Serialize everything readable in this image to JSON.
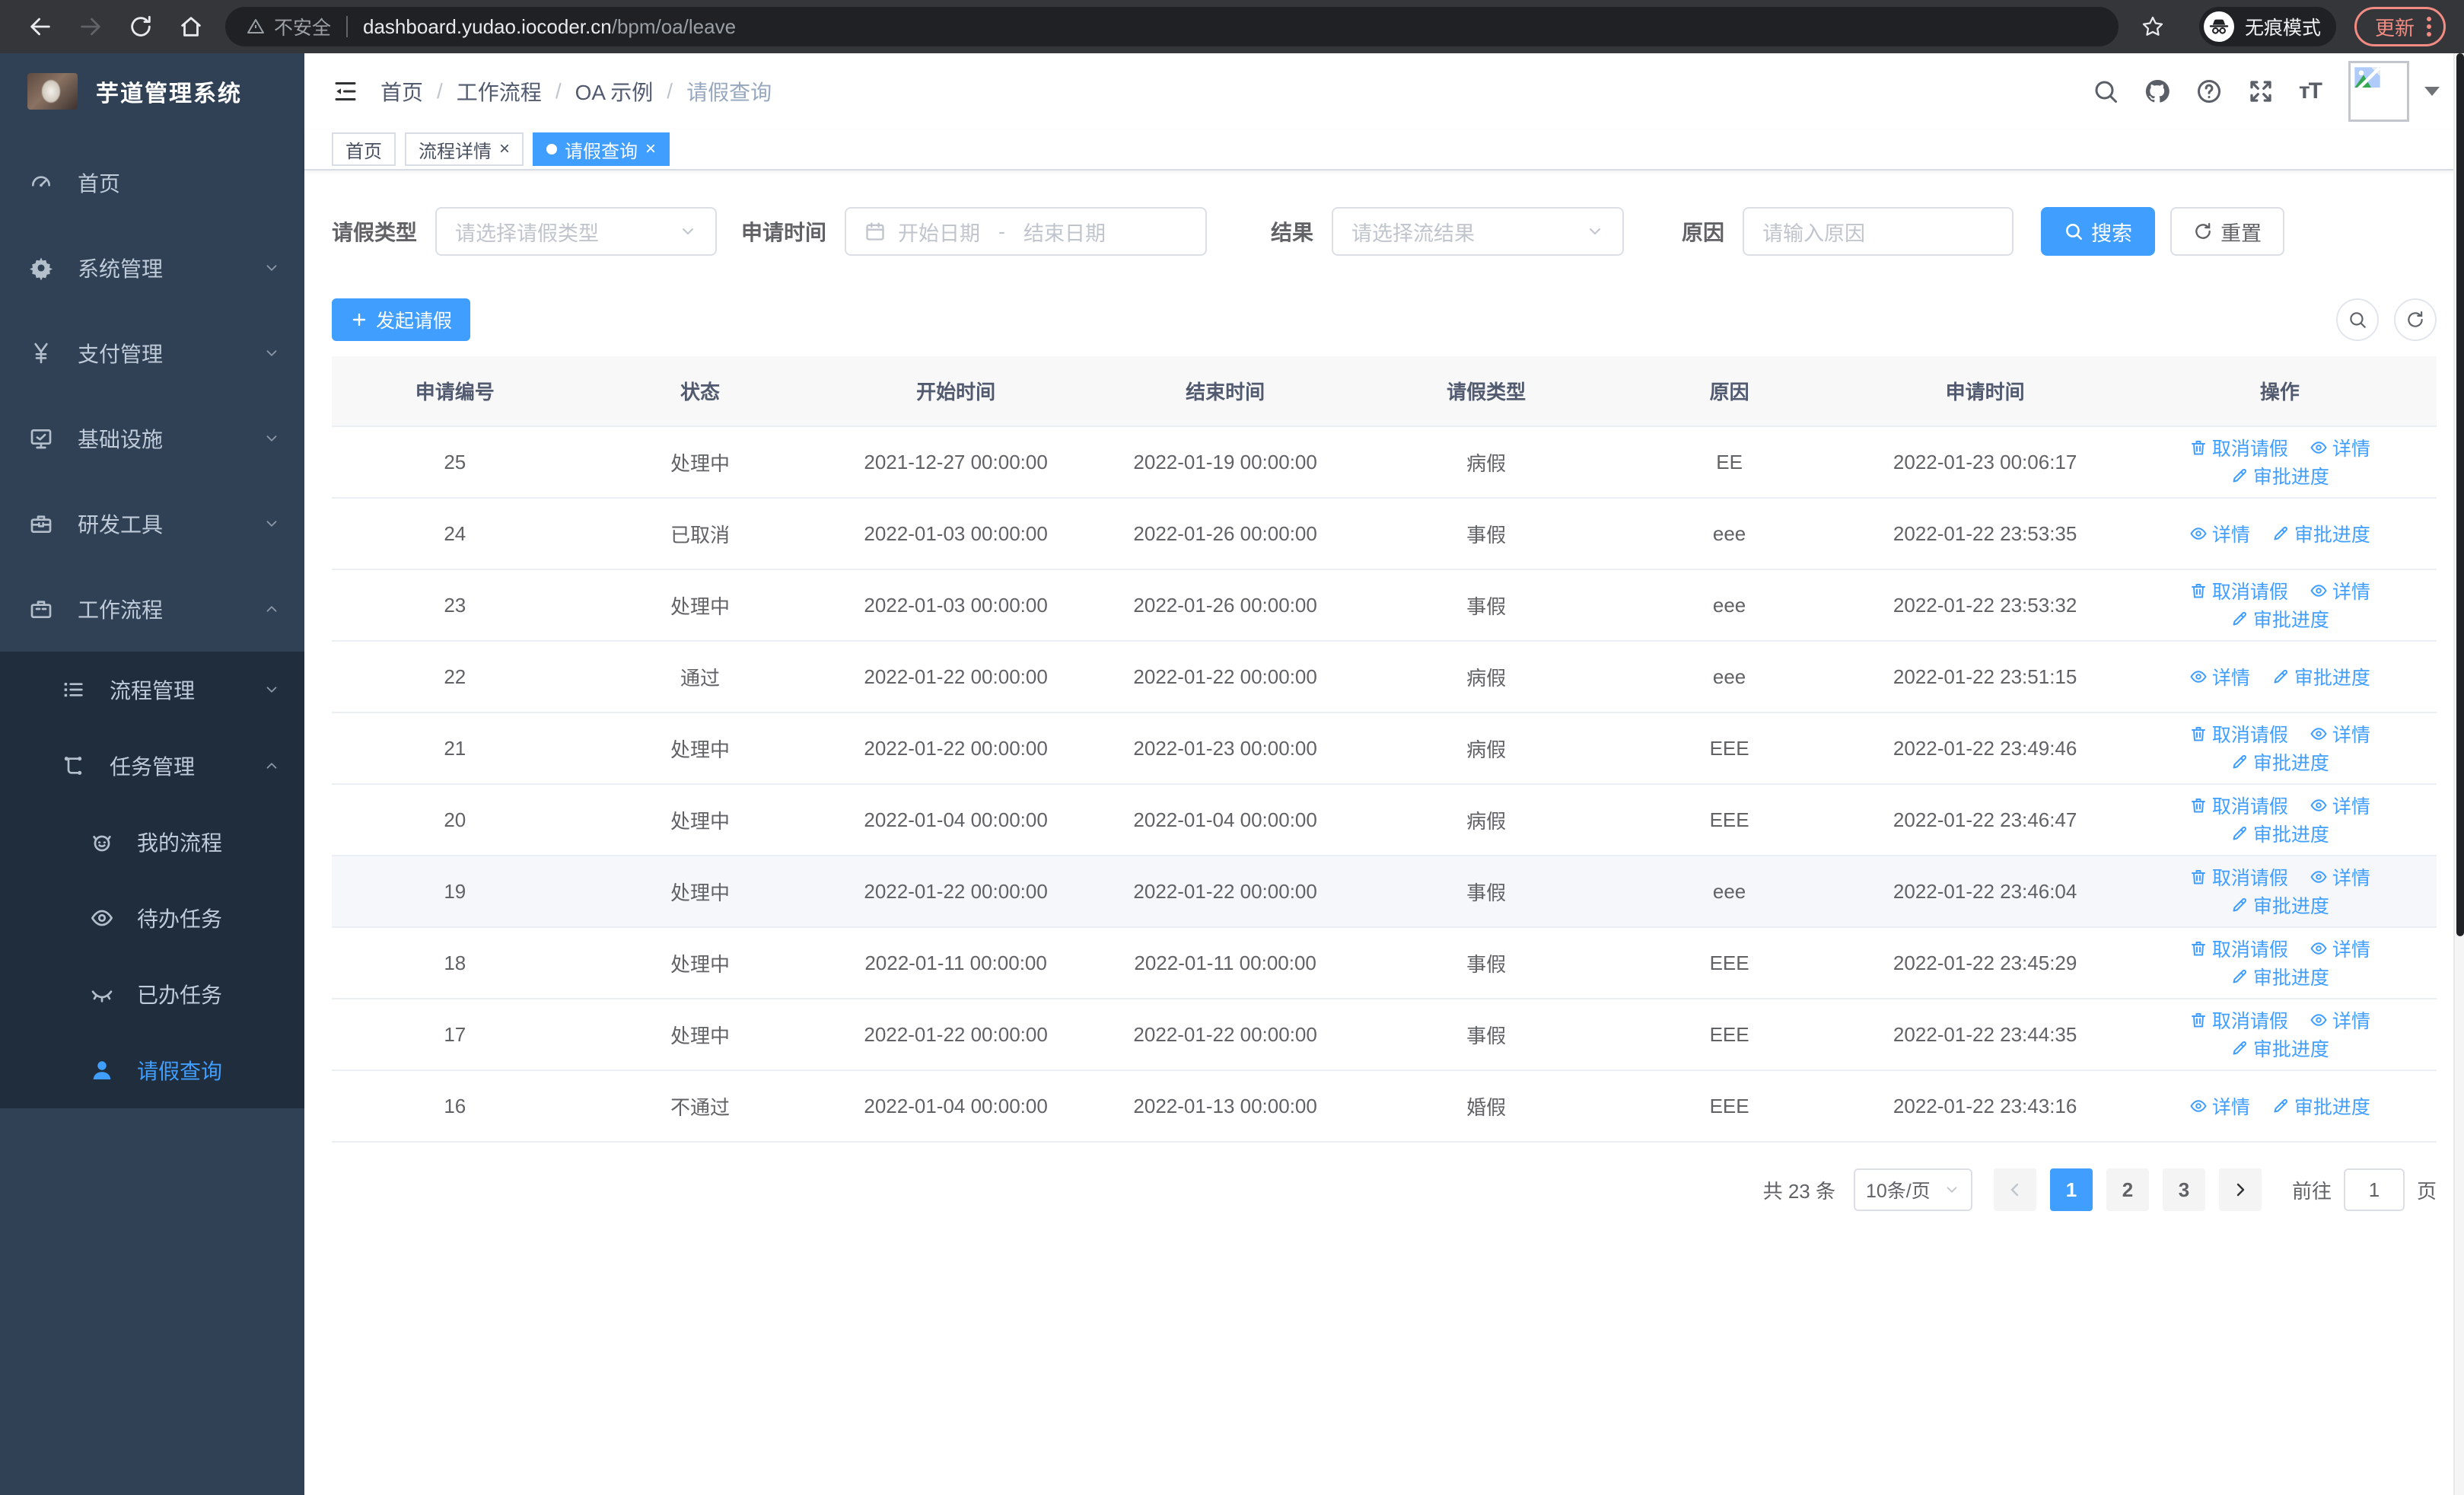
{
  "colors": {
    "primary": "#409EFF",
    "sidebar_bg": "#304156",
    "submenu_bg": "#1F2D3D",
    "update_accent": "#F28B82"
  },
  "browser": {
    "security_label": "不安全",
    "url_host": "dashboard.yudao.iocoder.cn",
    "url_path": "/bpm/oa/leave",
    "incognito_label": "无痕模式",
    "update_label": "更新"
  },
  "sidebar": {
    "title": "芋道管理系统",
    "items": [
      {
        "key": "home",
        "label": "首页",
        "icon": "dashboard",
        "level": 1,
        "chevron": "",
        "active": false
      },
      {
        "key": "system",
        "label": "系统管理",
        "icon": "gear",
        "level": 1,
        "chevron": "down",
        "active": false
      },
      {
        "key": "payment",
        "label": "支付管理",
        "icon": "yen",
        "level": 1,
        "chevron": "down",
        "active": false
      },
      {
        "key": "infra",
        "label": "基础设施",
        "icon": "monitor",
        "level": 1,
        "chevron": "down",
        "active": false
      },
      {
        "key": "devtools",
        "label": "研发工具",
        "icon": "toolbox",
        "level": 1,
        "chevron": "down",
        "active": false
      },
      {
        "key": "workflow",
        "label": "工作流程",
        "icon": "briefcase",
        "level": 1,
        "chevron": "up",
        "active": false
      },
      {
        "key": "process-mgmt",
        "label": "流程管理",
        "icon": "list",
        "level": 2,
        "chevron": "down",
        "active": false,
        "sub": true
      },
      {
        "key": "task-mgmt",
        "label": "任务管理",
        "icon": "tree",
        "level": 2,
        "chevron": "up",
        "active": false,
        "sub": true
      },
      {
        "key": "my-process",
        "label": "我的流程",
        "icon": "face",
        "level": 3,
        "chevron": "",
        "active": false,
        "sub": true
      },
      {
        "key": "todo-tasks",
        "label": "待办任务",
        "icon": "eye-open",
        "level": 3,
        "chevron": "",
        "active": false,
        "sub": true
      },
      {
        "key": "done-tasks",
        "label": "已办任务",
        "icon": "eye-closed",
        "level": 3,
        "chevron": "",
        "active": false,
        "sub": true
      },
      {
        "key": "leave-query",
        "label": "请假查询",
        "icon": "user",
        "level": 3,
        "chevron": "",
        "active": true,
        "sub": true
      }
    ]
  },
  "header": {
    "breadcrumb": [
      "首页",
      "工作流程",
      "OA 示例",
      "请假查询"
    ]
  },
  "tabs": [
    {
      "key": "home",
      "label": "首页",
      "closable": false,
      "active": false
    },
    {
      "key": "process-detail",
      "label": "流程详情",
      "closable": true,
      "active": false
    },
    {
      "key": "leave-query",
      "label": "请假查询",
      "closable": true,
      "active": true
    }
  ],
  "filters": {
    "leave_type_label": "请假类型",
    "leave_type_placeholder": "请选择请假类型",
    "apply_time_label": "申请时间",
    "date_start_placeholder": "开始日期",
    "date_separator": "-",
    "date_end_placeholder": "结束日期",
    "result_label": "结果",
    "result_placeholder": "请选择流结果",
    "reason_label": "原因",
    "reason_placeholder": "请输入原因",
    "search_label": "搜索",
    "reset_label": "重置"
  },
  "toolbar": {
    "create_label": "发起请假"
  },
  "table": {
    "columns": [
      "申请编号",
      "状态",
      "开始时间",
      "结束时间",
      "请假类型",
      "原因",
      "申请时间",
      "操作"
    ],
    "action_labels": {
      "cancel": "取消请假",
      "detail": "详情",
      "progress": "审批进度"
    },
    "rows": [
      {
        "id": "25",
        "status": "处理中",
        "start": "2021-12-27 00:00:00",
        "end": "2022-01-19 00:00:00",
        "type": "病假",
        "reason": "EE",
        "apply_time": "2022-01-23 00:06:17",
        "actions": [
          "cancel",
          "detail",
          "progress"
        ],
        "highlighted": false
      },
      {
        "id": "24",
        "status": "已取消",
        "start": "2022-01-03 00:00:00",
        "end": "2022-01-26 00:00:00",
        "type": "事假",
        "reason": "eee",
        "apply_time": "2022-01-22 23:53:35",
        "actions": [
          "detail",
          "progress"
        ],
        "highlighted": false
      },
      {
        "id": "23",
        "status": "处理中",
        "start": "2022-01-03 00:00:00",
        "end": "2022-01-26 00:00:00",
        "type": "事假",
        "reason": "eee",
        "apply_time": "2022-01-22 23:53:32",
        "actions": [
          "cancel",
          "detail",
          "progress"
        ],
        "highlighted": false
      },
      {
        "id": "22",
        "status": "通过",
        "start": "2022-01-22 00:00:00",
        "end": "2022-01-22 00:00:00",
        "type": "病假",
        "reason": "eee",
        "apply_time": "2022-01-22 23:51:15",
        "actions": [
          "detail",
          "progress"
        ],
        "highlighted": false
      },
      {
        "id": "21",
        "status": "处理中",
        "start": "2022-01-22 00:00:00",
        "end": "2022-01-23 00:00:00",
        "type": "病假",
        "reason": "EEE",
        "apply_time": "2022-01-22 23:49:46",
        "actions": [
          "cancel",
          "detail",
          "progress"
        ],
        "highlighted": false
      },
      {
        "id": "20",
        "status": "处理中",
        "start": "2022-01-04 00:00:00",
        "end": "2022-01-04 00:00:00",
        "type": "病假",
        "reason": "EEE",
        "apply_time": "2022-01-22 23:46:47",
        "actions": [
          "cancel",
          "detail",
          "progress"
        ],
        "highlighted": false
      },
      {
        "id": "19",
        "status": "处理中",
        "start": "2022-01-22 00:00:00",
        "end": "2022-01-22 00:00:00",
        "type": "事假",
        "reason": "eee",
        "apply_time": "2022-01-22 23:46:04",
        "actions": [
          "cancel",
          "detail",
          "progress"
        ],
        "highlighted": true
      },
      {
        "id": "18",
        "status": "处理中",
        "start": "2022-01-11 00:00:00",
        "end": "2022-01-11 00:00:00",
        "type": "事假",
        "reason": "EEE",
        "apply_time": "2022-01-22 23:45:29",
        "actions": [
          "cancel",
          "detail",
          "progress"
        ],
        "highlighted": false
      },
      {
        "id": "17",
        "status": "处理中",
        "start": "2022-01-22 00:00:00",
        "end": "2022-01-22 00:00:00",
        "type": "事假",
        "reason": "EEE",
        "apply_time": "2022-01-22 23:44:35",
        "actions": [
          "cancel",
          "detail",
          "progress"
        ],
        "highlighted": false
      },
      {
        "id": "16",
        "status": "不通过",
        "start": "2022-01-04 00:00:00",
        "end": "2022-01-13 00:00:00",
        "type": "婚假",
        "reason": "EEE",
        "apply_time": "2022-01-22 23:43:16",
        "actions": [
          "detail",
          "progress"
        ],
        "highlighted": false
      }
    ]
  },
  "pagination": {
    "total_label": "共 23 条",
    "page_size_label": "10条/页",
    "pages": [
      "1",
      "2",
      "3"
    ],
    "current_page": "1",
    "goto_label": "前往",
    "goto_value": "1",
    "page_unit_label": "页"
  }
}
